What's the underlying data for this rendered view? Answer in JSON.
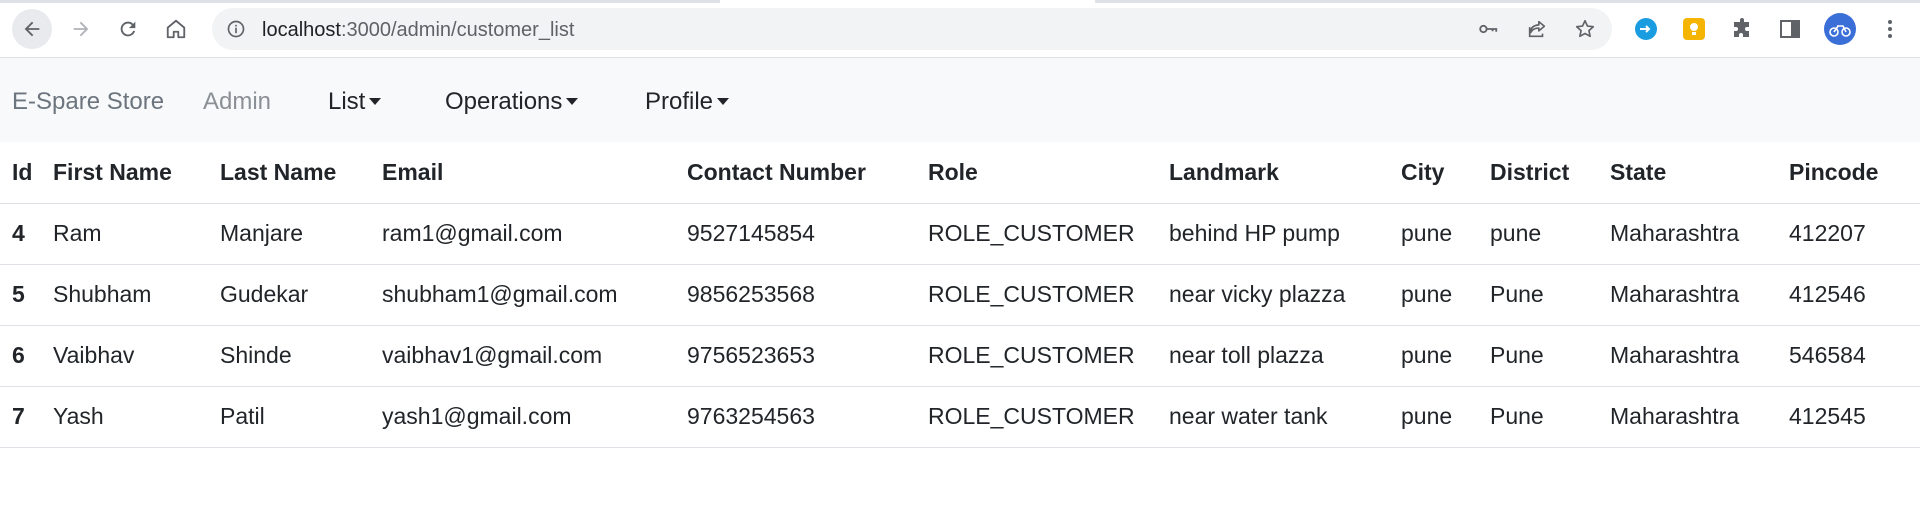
{
  "browser": {
    "url_host": "localhost",
    "url_path": ":3000/admin/customer_list"
  },
  "navbar": {
    "brand": "E-Spare Store",
    "admin": "Admin",
    "list": "List",
    "operations": "Operations",
    "profile": "Profile"
  },
  "table": {
    "headers": [
      "Id",
      "First Name",
      "Last Name",
      "Email",
      "Contact Number",
      "Role",
      "Landmark",
      "City",
      "District",
      "State",
      "Pincode"
    ],
    "rows": [
      [
        "4",
        "Ram",
        "Manjare",
        "ram1@gmail.com",
        "9527145854",
        "ROLE_CUSTOMER",
        "behind HP pump",
        "pune",
        "pune",
        "Maharashtra",
        "412207"
      ],
      [
        "5",
        "Shubham",
        "Gudekar",
        "shubham1@gmail.com",
        "9856253568",
        "ROLE_CUSTOMER",
        "near vicky plazza",
        "pune",
        "Pune",
        "Maharashtra",
        "412546"
      ],
      [
        "6",
        "Vaibhav",
        "Shinde",
        "vaibhav1@gmail.com",
        "9756523653",
        "ROLE_CUSTOMER",
        "near toll plazza",
        "pune",
        "Pune",
        "Maharashtra",
        "546584"
      ],
      [
        "7",
        "Yash",
        "Patil",
        "yash1@gmail.com",
        "9763254563",
        "ROLE_CUSTOMER",
        "near water tank",
        "pune",
        "Pune",
        "Maharashtra",
        "412545"
      ]
    ]
  },
  "colors": {
    "navbar_bg": "#f8f9fa",
    "brand_text": "#6c757d",
    "omnibox_bg": "#f1f3f4"
  }
}
